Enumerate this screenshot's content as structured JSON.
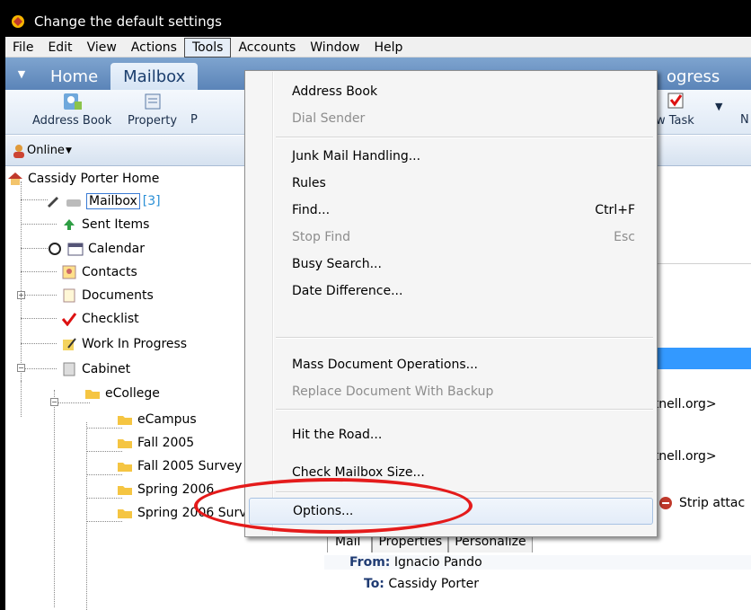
{
  "window": {
    "title": "Change the default settings"
  },
  "menubar": {
    "items": [
      "File",
      "Edit",
      "View",
      "Actions",
      "Tools",
      "Accounts",
      "Window",
      "Help"
    ],
    "active": "Tools"
  },
  "tabs": {
    "items": [
      "Home",
      "Mailbox",
      "ogress"
    ],
    "selected": "Mailbox"
  },
  "toolbar": {
    "address_book": "Address Book",
    "property": "Property",
    "p_cut": "P",
    "new_task": "w Task",
    "n_cut": "N"
  },
  "status": {
    "online": "Online"
  },
  "tree": {
    "root": "Cassidy Porter Home",
    "mailbox": "Mailbox",
    "mailbox_count": "[3]",
    "sent": "Sent Items",
    "calendar": "Calendar",
    "contacts": "Contacts",
    "documents": "Documents",
    "checklist": "Checklist",
    "work": "Work In Progress",
    "cabinet": "Cabinet",
    "ecollege": "eCollege",
    "ecampus": "eCampus",
    "fall2005": "Fall 2005",
    "fall2005survey": "Fall 2005 Survey",
    "spring2006": "Spring 2006",
    "spring2006survey": "Spring 2006 Survey"
  },
  "tools_menu": {
    "address_book": "Address Book",
    "dial_sender": "Dial Sender",
    "junk": "Junk Mail Handling...",
    "rules": "Rules",
    "find": "Find...",
    "find_sc": "Ctrl+F",
    "stop_find": "Stop Find",
    "stop_find_sc": "Esc",
    "busy": "Busy Search...",
    "date_diff": "Date Difference...",
    "mass_doc": "Mass Document Operations...",
    "replace_doc": "Replace Document With Backup",
    "hit_road": "Hit the Road...",
    "check_size": "Check Mailbox Size...",
    "options": "Options..."
  },
  "right": {
    "email1": "rtnell.org>",
    "email2": "rtnell.org>",
    "strip": "Strip attac",
    "tabs": [
      "Mail",
      "Properties",
      "Personalize"
    ],
    "from_label": "From:",
    "from": "Ignacio Pando",
    "to_label": "To:",
    "to": "Cassidy Porter"
  },
  "colors": {
    "highlight": "#3399ff",
    "callout": "#e41b1b",
    "tabbar": "#5b84b8"
  }
}
